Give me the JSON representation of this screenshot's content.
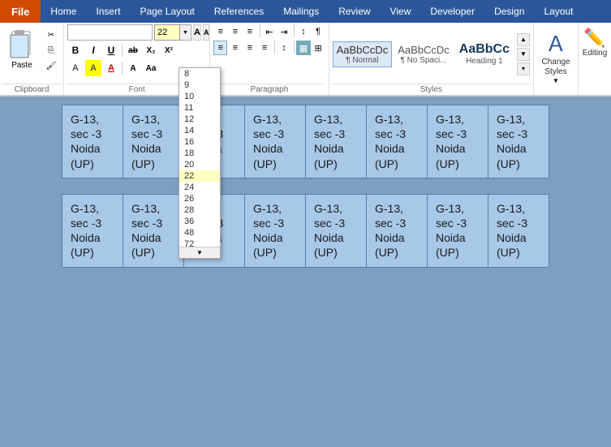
{
  "tabs": {
    "file": "File",
    "home": "Home",
    "insert": "Insert",
    "pageLayout": "Page Layout",
    "references": "References",
    "mailings": "Mailings",
    "review": "Review",
    "view": "View",
    "developer": "Developer",
    "design": "Design",
    "layout": "Layout"
  },
  "clipboard": {
    "label": "Clipboard",
    "paste": "Paste",
    "cut": "✂",
    "copy": "⎘",
    "formatPainter": "🖌"
  },
  "font": {
    "label": "Font",
    "name": "",
    "size": "22",
    "boldLabel": "B",
    "italicLabel": "I",
    "underlineLabel": "U",
    "strikethrough": "ab",
    "subscript": "X₂",
    "superscript": "X²",
    "fontColor": "A",
    "textHighlight": "A",
    "clearFormatting": "A"
  },
  "fontSizeDropdown": {
    "sizes": [
      "8",
      "9",
      "10",
      "11",
      "12",
      "14",
      "16",
      "18",
      "20",
      "22",
      "24",
      "26",
      "28",
      "36",
      "48",
      "72"
    ],
    "selected": "22"
  },
  "paragraph": {
    "label": "Paragraph"
  },
  "styles": {
    "label": "Styles",
    "items": [
      {
        "id": "normal",
        "preview": "AaBbCcDc",
        "label": "¶ Normal",
        "selected": true
      },
      {
        "id": "noSpacing",
        "preview": "AaBbCcDc",
        "label": "¶ No Spaci...",
        "selected": false
      },
      {
        "id": "heading1",
        "preview": "AaBbCc",
        "label": "Heading 1",
        "selected": false
      }
    ],
    "changeStyles": "Change\nStyles",
    "changeStylesLine1": "Change",
    "changeStylesLine2": "Styles"
  },
  "editing": {
    "label": "Editing"
  },
  "document": {
    "rows": [
      [
        "G-13,\nsec -3\nNoida\n(UP)",
        "G-13,\nsec -3\nNoida\n(UP)",
        "G-13,\nsec -3\nNoida\n(UP)",
        "G-13,\nsec -3\nNoida\n(UP)",
        "G-13,\nsec -3\nNoida\n(UP)",
        "G-13,\nsec -3\nNoida\n(UP)",
        "G-13,\nsec -3\nNoida\n(UP)",
        "G-13,\nsec -3\nNoida\n(UP)"
      ],
      [
        "G-13,\nsec -3\nNoida\n(UP)",
        "G-13,\nsec -3\nNoida\n(UP)",
        "G-13,\nsec -3\nNoida\n(UP)",
        "G-13,\nsec -3\nNoida\n(UP)",
        "G-13,\nsec -3\nNoida\n(UP)",
        "G-13,\nsec -3\nNoida\n(UP)",
        "G-13,\nsec -3\nNoida\n(UP)",
        "G-13,\nsec -3\nNoida\n(UP)"
      ]
    ]
  }
}
